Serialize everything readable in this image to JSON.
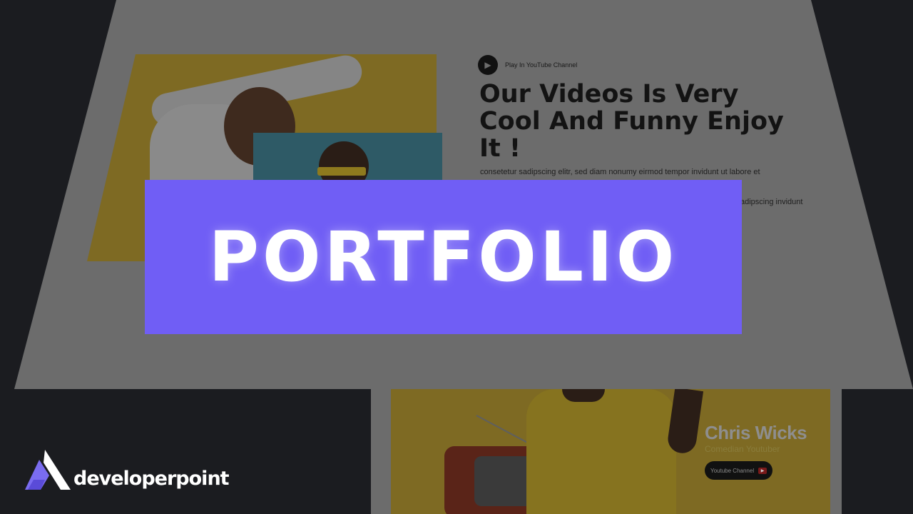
{
  "banner": {
    "title": "PORTFOLIO",
    "color": "#705ef5"
  },
  "mockup_top": {
    "yt_label": "Play In YouTube Channel",
    "play_icon": "play-icon",
    "headline": "Our Videos Is Very Cool And Funny Enjoy It !",
    "para1": "consetetur sadipscing elitr, sed diam nonumy eirmod tempor invidunt ut labore et",
    "para2": "adipscing invidunt"
  },
  "mockup_bottom": {
    "name": "Chris Wicks",
    "role": "Comedian Youtuber",
    "button_label": "Youtube Channel",
    "button_icon": "youtube-icon"
  },
  "logo": {
    "text": "developerpoint",
    "accent": "#7a6cf0"
  },
  "colors": {
    "background": "#1b1c20",
    "mockup": "#6c6c6c",
    "photo_yellow": "#7e6a23"
  }
}
